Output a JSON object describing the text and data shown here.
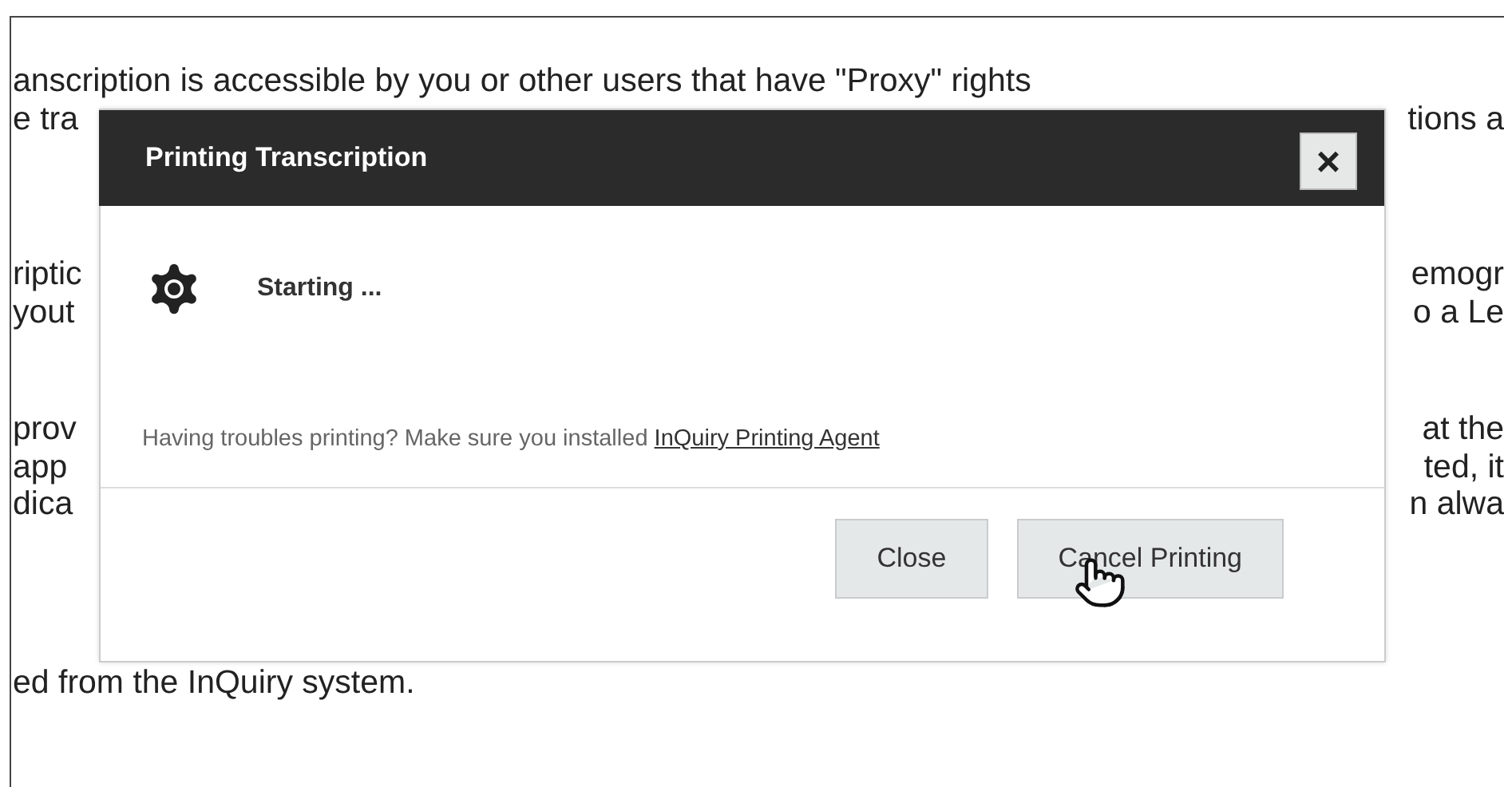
{
  "page": {
    "paragraphs": [
      {
        "lines": [
          {
            "left": "anscription is accessible by you or other users that have \"Proxy\" rights"
          },
          {
            "left": "e tra",
            "right": "tions a"
          }
        ]
      },
      {
        "lines": [
          {
            "left": "riptic",
            "right": "emogr"
          },
          {
            "left": "yout",
            "right": "o a Le"
          }
        ]
      },
      {
        "lines": [
          {
            "left": "prov",
            "right": "at the"
          },
          {
            "left": "app",
            "right": "ted, it"
          },
          {
            "left": "dica",
            "right": "n alwa"
          }
        ]
      },
      {
        "lines": [
          {
            "left": "ed from the InQuiry system."
          }
        ]
      }
    ]
  },
  "dialog": {
    "title": "Printing Transcription",
    "close_symbol": "×",
    "status": "Starting ...",
    "hint": "Having troubles printing? Make sure you installed",
    "link": "InQuiry Printing Agent",
    "buttons": [
      "Close",
      "Cancel Printing"
    ]
  }
}
